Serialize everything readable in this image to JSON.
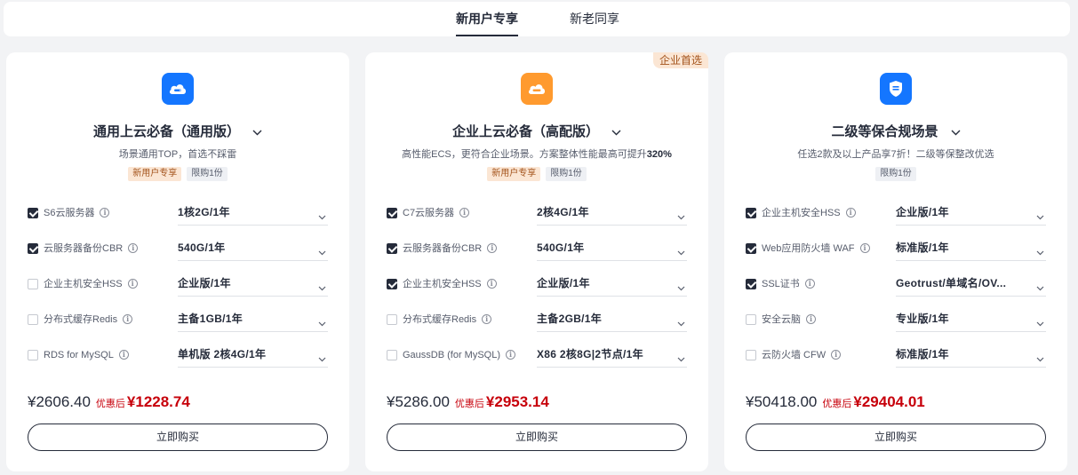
{
  "tabs": [
    {
      "label": "新用户专享",
      "active": true
    },
    {
      "label": "新老同享",
      "active": false
    }
  ],
  "colors": {
    "accent_blue": "#1476ff",
    "accent_orange": "#ff9a2e",
    "price_red": "#c7000b",
    "text": "#252b3a"
  },
  "cards": [
    {
      "icon": "cloud-server-icon",
      "title": "通用上云必备（通用版）",
      "subtitle": "场景通用TOP，首选不踩雷",
      "tags": [
        "新用户专享",
        "限购1份"
      ],
      "items": [
        {
          "checked": true,
          "name": "S6云服务器",
          "value": "1核2G/1年"
        },
        {
          "checked": true,
          "name": "云服务器备份CBR",
          "value": "540G/1年"
        },
        {
          "checked": false,
          "name": "企业主机安全HSS",
          "value": "企业版/1年"
        },
        {
          "checked": false,
          "name": "分布式缓存Redis",
          "value": "主备1GB/1年"
        },
        {
          "checked": false,
          "name": "RDS for MySQL",
          "value": "单机版 2核4G/1年"
        }
      ],
      "original_price": "¥2606.40",
      "discount_label": "优惠后",
      "final_price": "¥1228.74",
      "buy_label": "立即购买"
    },
    {
      "corner_badge": "企业首选",
      "icon": "server-icon",
      "title": "企业上云必备（高配版）",
      "subtitle_prefix": "高性能ECS，更符合企业场景。方案整体性能最高可提升",
      "subtitle_highlight": "320%",
      "tags": [
        "新用户专享",
        "限购1份"
      ],
      "items": [
        {
          "checked": true,
          "name": "C7云服务器",
          "value": "2核4G/1年"
        },
        {
          "checked": true,
          "name": "云服务器备份CBR",
          "value": "540G/1年"
        },
        {
          "checked": true,
          "name": "企业主机安全HSS",
          "value": "企业版/1年"
        },
        {
          "checked": false,
          "name": "分布式缓存Redis",
          "value": "主备2GB/1年"
        },
        {
          "checked": false,
          "name": "GaussDB (for MySQL)",
          "value": "X86 2核8G|2节点/1年"
        }
      ],
      "original_price": "¥5286.00",
      "discount_label": "优惠后",
      "final_price": "¥2953.14",
      "buy_label": "立即购买"
    },
    {
      "icon": "shield-icon",
      "title": "二级等保合规场景",
      "subtitle": "任选2款及以上产品享7折！二级等保整改优选",
      "tags": [
        "限购1份"
      ],
      "items": [
        {
          "checked": true,
          "name": "企业主机安全HSS",
          "value": "企业版/1年"
        },
        {
          "checked": true,
          "name": "Web应用防火墙 WAF",
          "value": "标准版/1年"
        },
        {
          "checked": true,
          "name": "SSL证书",
          "value": "Geotrust/单域名/OV..."
        },
        {
          "checked": false,
          "name": "安全云脑",
          "value": "专业版/1年"
        },
        {
          "checked": false,
          "name": "云防火墙 CFW",
          "value": "标准版/1年"
        }
      ],
      "original_price": "¥50418.00",
      "discount_label": "优惠后",
      "final_price": "¥29404.01",
      "buy_label": "立即购买"
    }
  ]
}
